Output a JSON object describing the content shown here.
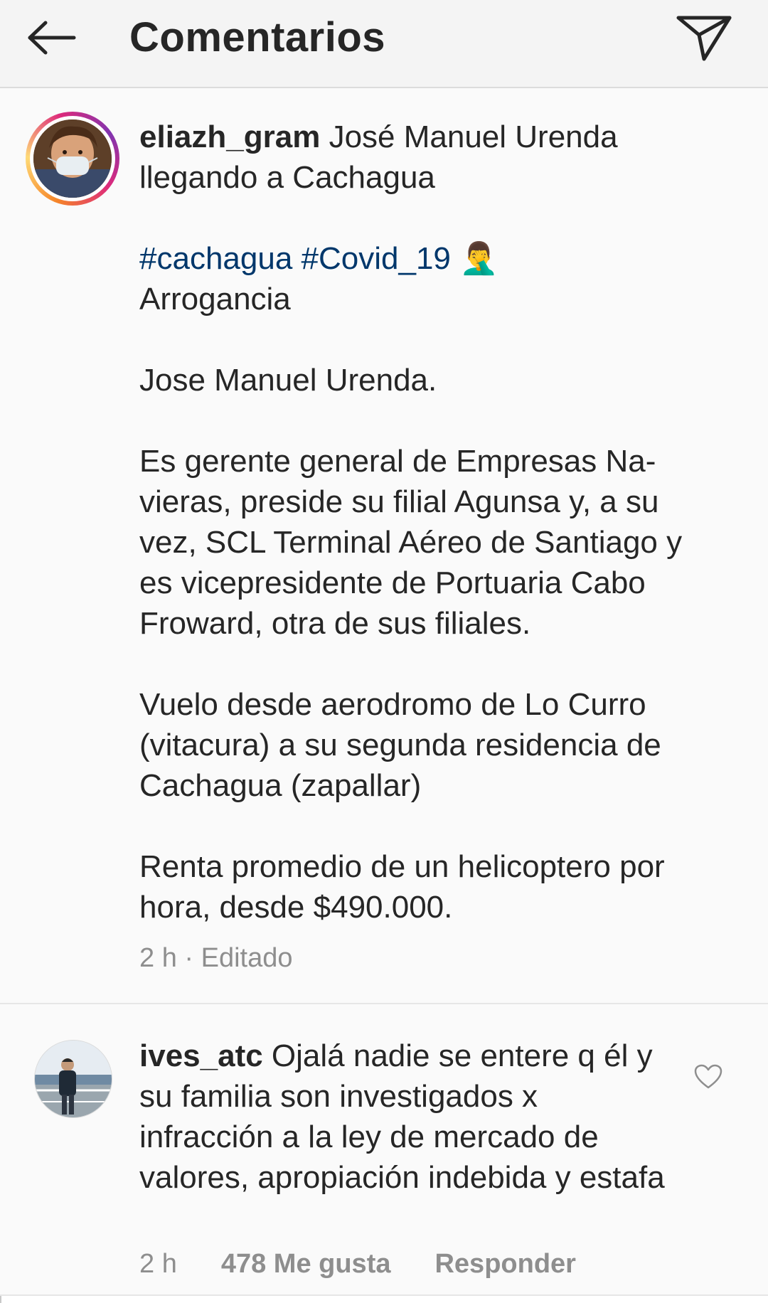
{
  "header": {
    "title": "Comentarios",
    "back_icon": "arrow-left-icon",
    "share_icon": "paper-plane-icon"
  },
  "caption": {
    "username": "eliazh_gram",
    "first_line": " José Manuel Urenda llegando a Cachagua",
    "hashtag1": "#cachagua",
    "hashtag2": "#Covid_19",
    "emoji": "🤦‍♂️",
    "line_arrogancia": "Arrogancia",
    "line_name": "Jose Manuel Urenda.",
    "para_gerente": "Es gerente general de Empresas Na-vieras, preside su filial Agunsa y, a su vez, SCL Terminal Aéreo de Santiago y es vicepresidente de Portuaria Cabo Froward, otra de sus filiales.",
    "para_vuelo": "Vuelo desde aerodromo de Lo Curro (vitacura) a su segunda residencia de Cachagua (zapallar)",
    "para_renta": "Renta promedio de un helicoptero por hora, desde $490.000.",
    "meta": "2 h · Editado"
  },
  "comment": {
    "username": "ives_atc",
    "text": " Ojalá nadie se entere q él y su familia son investigados x infracción a la ley de mercado de valores, apropiación indebida y estafa",
    "time": "2 h",
    "likes": "478 Me gusta",
    "reply": "Responder",
    "heart_icon": "heart-outline-icon"
  },
  "colors": {
    "hashtag": "#00376b",
    "meta": "#8e8e8e",
    "text": "#262626",
    "header_bg": "#f4f4f4",
    "body_bg": "#fafafa"
  }
}
